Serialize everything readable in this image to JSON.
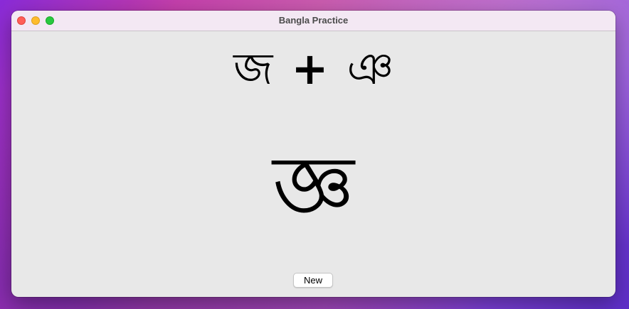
{
  "window": {
    "title": "Bangla Practice"
  },
  "exercise": {
    "left_character": "জ",
    "operator": "+",
    "right_character": "ঞ",
    "combined_character": "জ্ঞ"
  },
  "controls": {
    "new_label": "New"
  },
  "colors": {
    "close": "#ff5f57",
    "minimize": "#febc2e",
    "maximize": "#28c840",
    "window_background": "#e8e8e8",
    "titlebar_background": "#f3e8f3"
  }
}
